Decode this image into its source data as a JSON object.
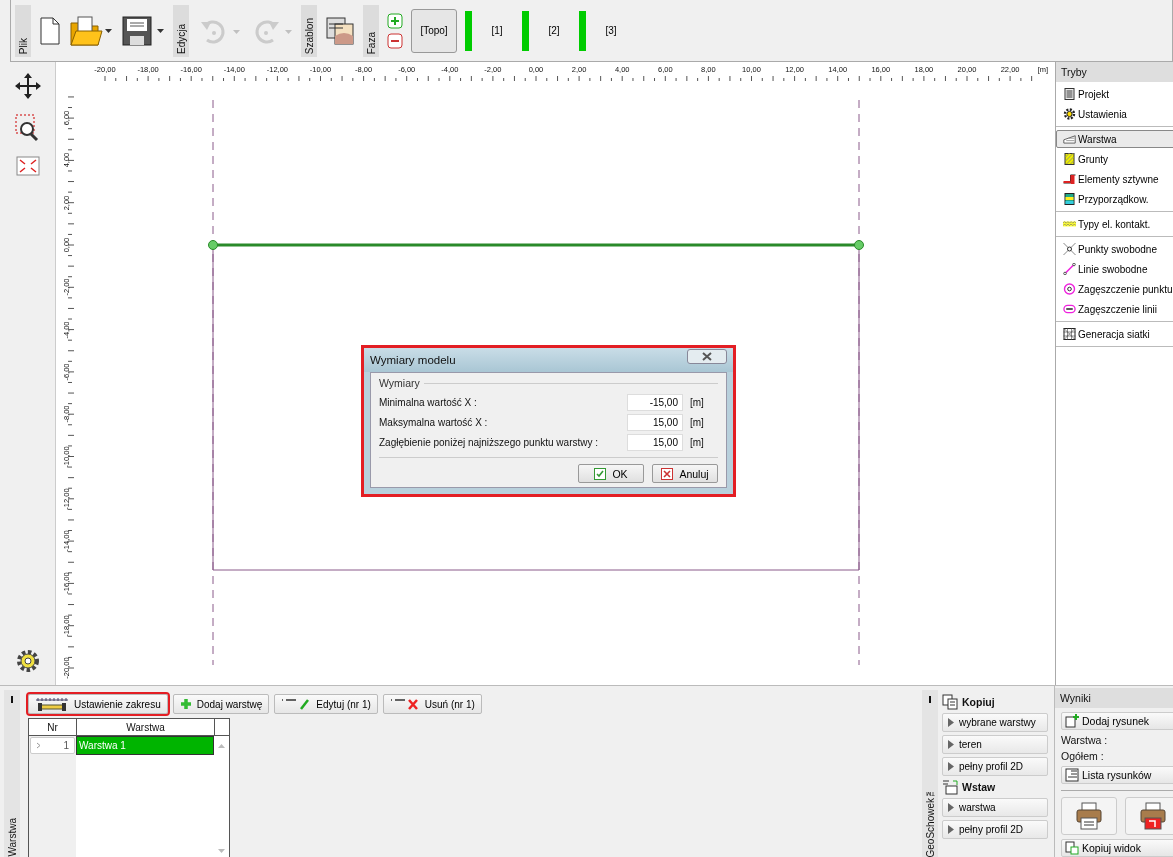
{
  "toolbar": {
    "file_label": "Plik",
    "edit_label": "Edycja",
    "undo": {
      "disabled": true
    },
    "redo": {
      "disabled": true
    },
    "template_label": "Szablon",
    "phase_label": "Faza",
    "phases": [
      {
        "label": "[Topo]",
        "selected": true
      },
      {
        "label": "[1]",
        "selected": false
      },
      {
        "label": "[2]",
        "selected": false
      },
      {
        "label": "[3]",
        "selected": false
      }
    ]
  },
  "ruler": {
    "x_labels": [
      "-20,00",
      "-18,00",
      "-16,00",
      "-14,00",
      "-12,00",
      "-10,00",
      "-8,00",
      "-6,00",
      "-4,00",
      "-2,00",
      "0,00",
      "2,00",
      "4,00",
      "6,00",
      "8,00",
      "10,00",
      "12,00",
      "14,00",
      "16,00",
      "18,00",
      "20,00",
      "22,00"
    ],
    "unit": "[m]",
    "y_labels": [
      "6,00",
      "4,00",
      "2,00",
      "0,00",
      "-2,00",
      "-4,00",
      "-6,00",
      "-8,00",
      "-10,00",
      "-12,00",
      "-14,00",
      "-16,00",
      "-18,00",
      "-20,00"
    ]
  },
  "dialog": {
    "title": "Wymiary modelu",
    "highlighted": true,
    "group": "Wymiary",
    "fields": [
      {
        "label": "Minimalna wartość X :",
        "value": "-15,00",
        "unit": "[m]"
      },
      {
        "label": "Maksymalna wartość X :",
        "value": "15,00",
        "unit": "[m]"
      },
      {
        "label": "Zagłębienie poniżej najniższego punktu warstwy :",
        "value": "15,00",
        "unit": "[m]"
      }
    ],
    "ok": "OK",
    "cancel": "Anuluj"
  },
  "modes": {
    "title": "Tryby",
    "groups": [
      [
        {
          "label": "Projekt",
          "selected": false
        },
        {
          "label": "Ustawienia",
          "selected": false
        }
      ],
      [
        {
          "label": "Warstwa",
          "selected": true
        },
        {
          "label": "Grunty",
          "selected": false
        },
        {
          "label": "Elementy sztywne",
          "selected": false
        },
        {
          "label": "Przyporządkow.",
          "selected": false
        }
      ],
      [
        {
          "label": "Typy el. kontakt.",
          "selected": false
        }
      ],
      [
        {
          "label": "Punkty swobodne",
          "selected": false
        },
        {
          "label": "Linie swobodne",
          "selected": false
        },
        {
          "label": "Zagęszczenie punktu",
          "selected": false
        },
        {
          "label": "Zagęszczenie linii",
          "selected": false
        }
      ],
      [
        {
          "label": "Generacja siatki",
          "selected": false
        }
      ]
    ]
  },
  "layer_panel": {
    "tab": "Warstwa",
    "buttons": [
      {
        "label": "Ustawienie zakresu",
        "highlighted": true
      },
      {
        "label": "Dodaj warstwę",
        "highlighted": false
      },
      {
        "label": "Edytuj (nr 1)",
        "highlighted": false
      },
      {
        "label": "Usuń (nr 1)",
        "highlighted": false
      }
    ],
    "table": {
      "columns": [
        "Nr",
        "Warstwa"
      ],
      "rows": [
        {
          "nr": "1",
          "name": "Warstwa 1",
          "selected": true
        }
      ]
    }
  },
  "clipboard": {
    "tab": "GeoSchowek™",
    "copy_title": "Kopiuj",
    "copy_items": [
      "wybrane warstwy",
      "teren",
      "pełny profil 2D"
    ],
    "paste_title": "Wstaw",
    "paste_items": [
      "warstwa",
      "pełny profil 2D"
    ]
  },
  "results": {
    "title": "Wyniki",
    "add_drawing": "Dodaj rysunek",
    "layer_label": "Warstwa :",
    "total_label": "Ogółem :",
    "drawing_list": "Lista rysunków",
    "copy_view": "Kopiuj widok"
  }
}
